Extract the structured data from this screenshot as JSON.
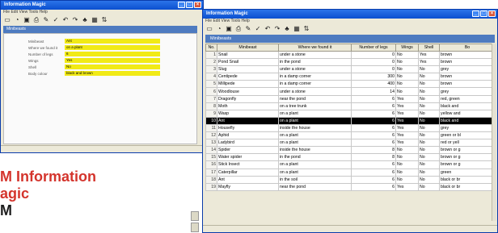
{
  "left_window": {
    "title": "Information Magic",
    "menu": "File  Edit  View  Tools  Help",
    "toolbar_icons": [
      "new-icon",
      "open-icon",
      "save-icon",
      "print-icon",
      "pencil-icon",
      "check-icon",
      "undo-icon",
      "redo-icon",
      "tree-icon",
      "table-icon",
      "sort-icon"
    ],
    "form_title": "Minibeasts",
    "fields": [
      {
        "label": "Minibeast",
        "value": "Ant"
      },
      {
        "label": "Where we found it",
        "value": "on a plant"
      },
      {
        "label": "Number of legs",
        "value": "6"
      },
      {
        "label": "Wings",
        "value": "Yes"
      },
      {
        "label": "Shell",
        "value": "No"
      },
      {
        "label": "Body colour",
        "value": "black and brown"
      }
    ]
  },
  "right_window": {
    "title": "Information Magic",
    "menu": "File  Edit  View  Tools  Help",
    "toolbar_icons": [
      "new-icon",
      "open-icon",
      "save-icon",
      "print-icon",
      "pencil-icon",
      "check-icon",
      "undo-icon",
      "redo-icon",
      "tree-icon",
      "table-icon",
      "sort-icon"
    ],
    "panel_title": "Minibeasts",
    "columns": [
      "No.",
      "Minibeast",
      "Where we found it",
      "Number of legs",
      "Wings",
      "Shell",
      "Bo"
    ],
    "rows": [
      {
        "no": "1",
        "name": "Snail",
        "where": "under a stone",
        "legs": "0",
        "wings": "No",
        "shell": "Yes",
        "body": "brown"
      },
      {
        "no": "2",
        "name": "Pond Snail",
        "where": "in the pond",
        "legs": "0",
        "wings": "No",
        "shell": "Yes",
        "body": "brown"
      },
      {
        "no": "3",
        "name": "Slug",
        "where": "under a stone",
        "legs": "0",
        "wings": "No",
        "shell": "No",
        "body": "grey"
      },
      {
        "no": "4",
        "name": "Centipede",
        "where": "in a damp corner",
        "legs": "300",
        "wings": "No",
        "shell": "No",
        "body": "brown"
      },
      {
        "no": "5",
        "name": "Millipede",
        "where": "in a damp corner",
        "legs": "400",
        "wings": "No",
        "shell": "No",
        "body": "brown"
      },
      {
        "no": "6",
        "name": "Woodlouse",
        "where": "under a stone",
        "legs": "14",
        "wings": "No",
        "shell": "No",
        "body": "grey"
      },
      {
        "no": "7",
        "name": "Dragonfly",
        "where": "near the pond",
        "legs": "6",
        "wings": "Yes",
        "shell": "No",
        "body": "red, green"
      },
      {
        "no": "8",
        "name": "Moth",
        "where": "on a tree trunk",
        "legs": "6",
        "wings": "Yes",
        "shell": "No",
        "body": "black and"
      },
      {
        "no": "9",
        "name": "Wasp",
        "where": "on a plant",
        "legs": "6",
        "wings": "Yes",
        "shell": "No",
        "body": "yellow and"
      },
      {
        "no": "10",
        "name": "Ant",
        "where": "on a plant",
        "legs": "6",
        "wings": "Yes",
        "shell": "No",
        "body": "black and"
      },
      {
        "no": "11",
        "name": "Housefly",
        "where": "inside the house",
        "legs": "6",
        "wings": "Yes",
        "shell": "No",
        "body": "grey"
      },
      {
        "no": "12",
        "name": "Aphid",
        "where": "on a plant",
        "legs": "6",
        "wings": "Yes",
        "shell": "No",
        "body": "green or bl"
      },
      {
        "no": "13",
        "name": "Ladybird",
        "where": "on a plant",
        "legs": "6",
        "wings": "Yes",
        "shell": "No",
        "body": "red or yell"
      },
      {
        "no": "14",
        "name": "Spider",
        "where": "inside the house",
        "legs": "8",
        "wings": "No",
        "shell": "No",
        "body": "brown or g"
      },
      {
        "no": "15",
        "name": "Water spider",
        "where": "in the pond",
        "legs": "8",
        "wings": "No",
        "shell": "No",
        "body": "brown or g"
      },
      {
        "no": "16",
        "name": "Stick Insect",
        "where": "on a plant",
        "legs": "6",
        "wings": "No",
        "shell": "No",
        "body": "brown or g"
      },
      {
        "no": "17",
        "name": "Caterpillar",
        "where": "on a plant",
        "legs": "6",
        "wings": "No",
        "shell": "No",
        "body": "green"
      },
      {
        "no": "18",
        "name": "Ant",
        "where": "in the soil",
        "legs": "6",
        "wings": "No",
        "shell": "No",
        "body": "black or br"
      },
      {
        "no": "19",
        "name": "Mayfly",
        "where": "near the pond",
        "legs": "6",
        "wings": "Yes",
        "shell": "No",
        "body": "black or br"
      }
    ],
    "selected_row_index": 9
  },
  "caption": {
    "line1": "M Information",
    "line2": "agic",
    "line3": "M"
  },
  "colors": {
    "title_blue": "#0a4fcf",
    "band_blue": "#4e7bc0",
    "field_yellow": "#f1ea16",
    "caption_red": "#d4342c",
    "selected_row": "#000000"
  }
}
